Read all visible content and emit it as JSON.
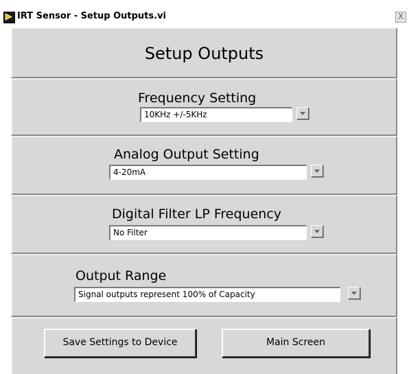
{
  "window": {
    "title": "IRT Sensor - Setup Outputs.vi",
    "close_label": "X"
  },
  "heading": "Setup Outputs",
  "frequency": {
    "label": "Frequency Setting",
    "value": "10KHz +/-5KHz"
  },
  "analog": {
    "label": "Analog Output Setting",
    "value": "4-20mA"
  },
  "filter": {
    "label": "Digital Filter LP Frequency",
    "value": "No Filter"
  },
  "range": {
    "label": "Output Range",
    "value": "Signal outputs represent 100% of Capacity"
  },
  "buttons": {
    "save": "Save Settings to Device",
    "main": "Main Screen"
  },
  "icons": {
    "window": "labview-vi-icon",
    "dropdown": "chevron-down-icon"
  }
}
